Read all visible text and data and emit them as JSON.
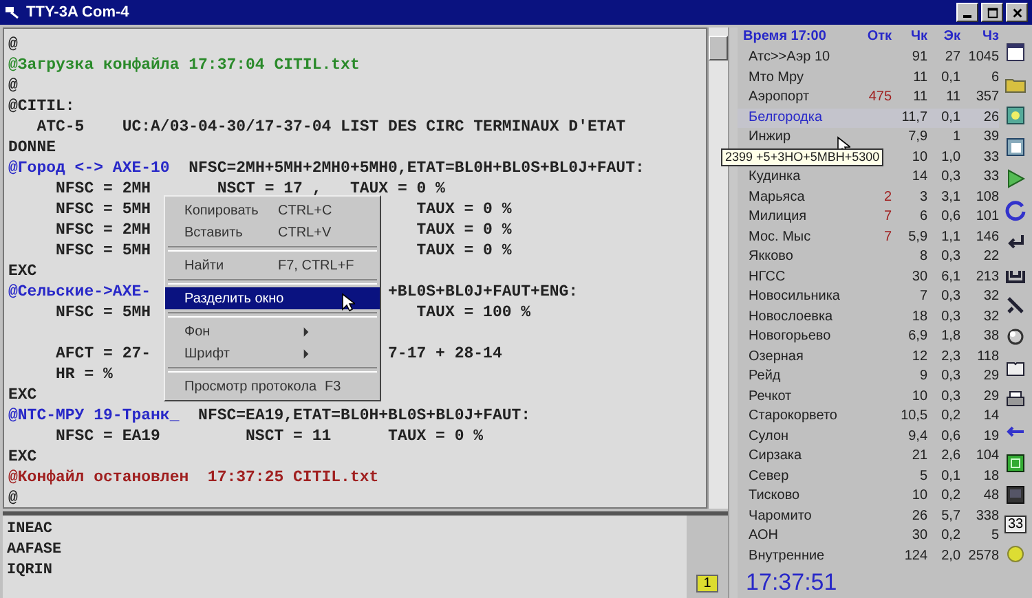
{
  "window": {
    "title": "TTY-3A Com-4"
  },
  "console": {
    "lines": [
      {
        "kind": "plain",
        "text": "@"
      },
      {
        "kind": "loaded",
        "text": "@Загрузка конфайла 17:37:04 CITIL.txt"
      },
      {
        "kind": "plain",
        "text": "@"
      },
      {
        "kind": "plain",
        "text": "@CITIL:"
      },
      {
        "kind": "plain",
        "text": "   ATC-5    UC:A/03-04-30/17-37-04 LIST DES CIRC TERMINAUX D'ETAT"
      },
      {
        "kind": "plain",
        "text": "DONNE"
      },
      {
        "kind": "group",
        "label": "@Город <-> АХЕ-10",
        "text": "  NFSC=2МН+5МН+2МН0+5МН0,ETAT=BL0H+BL0S+BL0J+FAUT:"
      },
      {
        "kind": "plain",
        "text": "     NFSC = 2МН       NSCT = 17 ,   TAUX = 0 %"
      },
      {
        "kind": "plain",
        "text": "     NFSC = 5МН",
        "right": "   TAUX = 0 %"
      },
      {
        "kind": "plain",
        "text": "     NFSC = 2МН",
        "right": "   TAUX = 0 %"
      },
      {
        "kind": "plain",
        "text": "     NFSC = 5МН",
        "right": "   TAUX = 0 %"
      },
      {
        "kind": "plain",
        "text": "EXC"
      },
      {
        "kind": "group",
        "label": "@Сельские->АХЕ-",
        "right": "+BL0S+BL0J+FAUT+ENG:"
      },
      {
        "kind": "plain",
        "text": "     NFSC = 5МН",
        "right": "   TAUX = 100 %"
      },
      {
        "kind": "blank"
      },
      {
        "kind": "plain",
        "text": "     AFCT = 27-",
        "right": "7-17 + 28-14"
      },
      {
        "kind": "plain",
        "text": "     HR = %"
      },
      {
        "kind": "plain",
        "text": "EXC"
      },
      {
        "kind": "group",
        "label": "@NTC-МРУ 19-Транк_",
        "text": "  NFSC=EA19,ETAT=BL0H+BL0S+BL0J+FAUT:"
      },
      {
        "kind": "plain",
        "text": "     NFSC = EA19         NSCT = 11      TAUX = 0 %"
      },
      {
        "kind": "plain",
        "text": "EXC"
      },
      {
        "kind": "stopped",
        "text": "@Конфайл остановлен  17:37:25 CITIL.txt"
      },
      {
        "kind": "plain",
        "text": "@"
      }
    ]
  },
  "context_menu": {
    "items": [
      {
        "kind": "item",
        "label": "Копировать",
        "shortcut": "CTRL+C",
        "selected": false
      },
      {
        "kind": "item",
        "label": "Вставить",
        "shortcut": "CTRL+V",
        "selected": false
      },
      {
        "kind": "separator"
      },
      {
        "kind": "item",
        "label": "Найти",
        "shortcut": "F7, CTRL+F",
        "selected": false
      },
      {
        "kind": "separator"
      },
      {
        "kind": "item",
        "label": "Разделить окно",
        "selected": true
      },
      {
        "kind": "separator"
      },
      {
        "kind": "submenu",
        "label": "Фон",
        "selected": false
      },
      {
        "kind": "submenu",
        "label": "Шрифт",
        "selected": false
      },
      {
        "kind": "separator"
      },
      {
        "kind": "item",
        "label": "Просмотр протокола",
        "shortcut": "F3",
        "selected": false
      }
    ]
  },
  "input": {
    "lines": [
      "INEAC",
      "AAFASE",
      "IQRIN"
    ],
    "marker": "1"
  },
  "table": {
    "columns": [
      "Время 17:00",
      "Отк",
      "Чк",
      "Эк",
      "Чз"
    ],
    "rows": [
      {
        "cells": [
          "Атс>>Аэр 10",
          "",
          "91",
          "27",
          "1045"
        ],
        "selected": false
      },
      {
        "cells": [
          "Мто Мру",
          "",
          "11",
          "0,1",
          "6"
        ],
        "selected": false
      },
      {
        "cells": [
          "Аэропорт",
          "475",
          "11",
          "11",
          "357"
        ],
        "selected": false
      },
      {
        "cells": [
          "Белгородка",
          "",
          "11,7",
          "0,1",
          "26"
        ],
        "selected": true
      },
      {
        "cells": [
          "Инжир",
          "",
          "7,9",
          "1",
          "39"
        ],
        "selected": false
      },
      {
        "cells": [
          "",
          "",
          "10",
          "1,0",
          "33"
        ],
        "selected": false
      },
      {
        "cells": [
          "Кудинка",
          "",
          "14",
          "0,3",
          "33"
        ],
        "selected": false
      },
      {
        "cells": [
          "Марьяса",
          "2",
          "3",
          "3,1",
          "108"
        ],
        "selected": false
      },
      {
        "cells": [
          "Милиция",
          "7",
          "6",
          "0,6",
          "101"
        ],
        "selected": false
      },
      {
        "cells": [
          "Мос. Мыс",
          "7",
          "5,9",
          "1,1",
          "146"
        ],
        "selected": false
      },
      {
        "cells": [
          "Якково",
          "",
          "8",
          "0,3",
          "22"
        ],
        "selected": false
      },
      {
        "cells": [
          "НГСС",
          "",
          "30",
          "6,1",
          "213"
        ],
        "selected": false
      },
      {
        "cells": [
          "Новосильника",
          "",
          "7",
          "0,3",
          "32"
        ],
        "selected": false
      },
      {
        "cells": [
          "Новослоевка",
          "",
          "18",
          "0,3",
          "32"
        ],
        "selected": false
      },
      {
        "cells": [
          "Новогорьево",
          "",
          "6,9",
          "1,8",
          "38"
        ],
        "selected": false
      },
      {
        "cells": [
          "Озерная",
          "",
          "12",
          "2,3",
          "118"
        ],
        "selected": false
      },
      {
        "cells": [
          "Рейд",
          "",
          "9",
          "0,3",
          "29"
        ],
        "selected": false
      },
      {
        "cells": [
          "Речкот",
          "",
          "10",
          "0,3",
          "29"
        ],
        "selected": false
      },
      {
        "cells": [
          "Старокорвето",
          "",
          "10,5",
          "0,2",
          "14"
        ],
        "selected": false
      },
      {
        "cells": [
          "Сулон",
          "",
          "9,4",
          "0,6",
          "19"
        ],
        "selected": false
      },
      {
        "cells": [
          "Сирзака",
          "",
          "21",
          "2,6",
          "104"
        ],
        "selected": false
      },
      {
        "cells": [
          "Север",
          "",
          "5",
          "0,1",
          "18"
        ],
        "selected": false
      },
      {
        "cells": [
          "Тисково",
          "",
          "10",
          "0,2",
          "48"
        ],
        "selected": false
      },
      {
        "cells": [
          "Чаромито",
          "",
          "26",
          "5,7",
          "338"
        ],
        "selected": false
      },
      {
        "cells": [
          "АОН",
          "",
          "30",
          "0,2",
          "5"
        ],
        "selected": false
      },
      {
        "cells": [
          "Внутренние",
          "",
          "124",
          "2,0",
          "2578"
        ],
        "selected": false
      }
    ]
  },
  "tooltip": "2399 +5+3НО+5МВН+5300",
  "clock": "17:37:51",
  "toolbar": {
    "counter": "33"
  }
}
